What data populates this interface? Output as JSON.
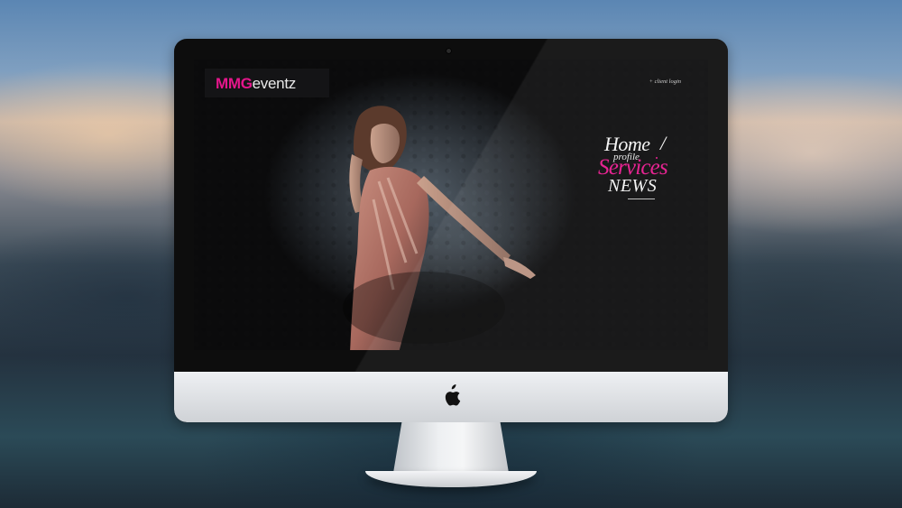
{
  "site": {
    "logo": {
      "part1": "MMG",
      "part2": "eventz"
    },
    "header": {
      "client_login": "+ client login"
    },
    "nav": {
      "home": "Home",
      "slash": "/",
      "profile": "profile",
      "services": "Services",
      "news": "NEWS"
    }
  },
  "colors": {
    "accent": "#e5168b",
    "screen_bg": "#0b0b0c",
    "nav_text": "#f2f2f2"
  },
  "icons": {
    "device_logo": "apple-logo-icon",
    "camera": "webcam-icon"
  }
}
